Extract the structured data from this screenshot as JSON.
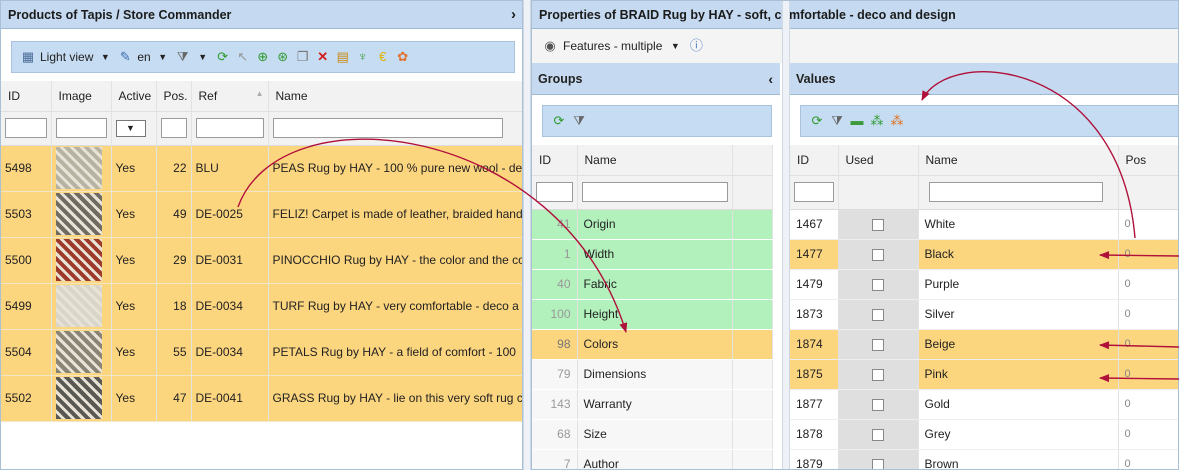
{
  "left": {
    "title": "Products of Tapis / Store Commander",
    "toolbar": {
      "view_label": "Light view",
      "lang_label": "en"
    },
    "columns": [
      "ID",
      "Image",
      "Active",
      "Pos.",
      "Ref",
      "Name"
    ],
    "active_filter": "▼",
    "rows": [
      {
        "id": "5498",
        "active": "Yes",
        "pos": "22",
        "ref": "BLU",
        "name": "PEAS Rug by HAY - 100 % pure new wool - de",
        "thumb": "#b7b3a2"
      },
      {
        "id": "5503",
        "active": "Yes",
        "pos": "49",
        "ref": "DE-0025",
        "name": "FELIZ! Carpet is made of leather, braided hand",
        "thumb": "#6f6a62"
      },
      {
        "id": "5500",
        "active": "Yes",
        "pos": "29",
        "ref": "DE-0031",
        "name": "PINOCCHIO Rug by HAY - the color and the co",
        "thumb": "#9e3a2c"
      },
      {
        "id": "5499",
        "active": "Yes",
        "pos": "18",
        "ref": "DE-0034",
        "name": "TURF Rug by HAY - very comfortable - deco a",
        "thumb": "#d9d5c8"
      },
      {
        "id": "5504",
        "active": "Yes",
        "pos": "55",
        "ref": "DE-0034",
        "name": "PETALS Rug by HAY - a field of comfort - 100",
        "thumb": "#8a8475"
      },
      {
        "id": "5502",
        "active": "Yes",
        "pos": "47",
        "ref": "DE-0041",
        "name": "GRASS Rug by HAY - lie on this very soft rug c",
        "thumb": "#5a5852"
      }
    ]
  },
  "right": {
    "title": "Properties of BRAID Rug by HAY - soft, comfortable - deco and design",
    "mode_label": "Features - multiple",
    "groups": {
      "title": "Groups",
      "columns": [
        "ID",
        "Name"
      ],
      "rows": [
        {
          "id": "41",
          "name": "Origin",
          "state": "green"
        },
        {
          "id": "1",
          "name": "Width",
          "state": "green"
        },
        {
          "id": "40",
          "name": "Fabric",
          "state": "green"
        },
        {
          "id": "100",
          "name": "Height",
          "state": "green"
        },
        {
          "id": "98",
          "name": "Colors",
          "state": "sel"
        },
        {
          "id": "79",
          "name": "Dimensions",
          "state": "plain"
        },
        {
          "id": "143",
          "name": "Warranty",
          "state": "plain"
        },
        {
          "id": "68",
          "name": "Size",
          "state": "plain"
        },
        {
          "id": "7",
          "name": "Author",
          "state": "plain"
        }
      ]
    },
    "values": {
      "title": "Values",
      "columns": [
        "ID",
        "Used",
        "Name",
        "Pos"
      ],
      "rows": [
        {
          "id": "1467",
          "name": "White",
          "pos": "0",
          "sel": false
        },
        {
          "id": "1477",
          "name": "Black",
          "pos": "0",
          "sel": true
        },
        {
          "id": "1479",
          "name": "Purple",
          "pos": "0",
          "sel": false
        },
        {
          "id": "1873",
          "name": "Silver",
          "pos": "0",
          "sel": false
        },
        {
          "id": "1874",
          "name": "Beige",
          "pos": "0",
          "sel": true
        },
        {
          "id": "1875",
          "name": "Pink",
          "pos": "0",
          "sel": true
        },
        {
          "id": "1877",
          "name": "Gold",
          "pos": "0",
          "sel": false
        },
        {
          "id": "1878",
          "name": "Grey",
          "pos": "0",
          "sel": false
        },
        {
          "id": "1879",
          "name": "Brown",
          "pos": "0",
          "sel": false
        }
      ]
    }
  },
  "colors": {
    "selected_row": "#fcd57f",
    "used_group": "#b2f0bc",
    "header": "#c5daf0",
    "arrow": "#b0103a"
  }
}
